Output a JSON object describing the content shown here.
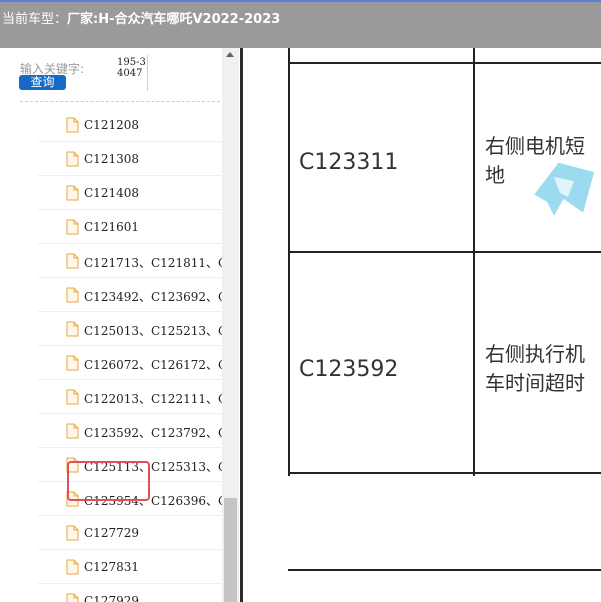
{
  "header": {
    "label": "当前车型：",
    "model": "厂家:H-合众汽车哪吒V2022-2023"
  },
  "sidebar": {
    "search": {
      "label": "输入关键字:",
      "value": "195-34047",
      "button": "查询"
    },
    "items": [
      "C121208",
      "C121308",
      "C121408",
      "C121601",
      "C121713、C121811、C",
      "C123492、C123692、C",
      "C125013、C125213、C",
      "C126072、C126172、C",
      "C122013、C122111、C",
      "C123592、C123792、C",
      "C125113、C125313、C",
      "C125954、C126396、C",
      "C127729",
      "C127831",
      "C127929"
    ]
  },
  "document": {
    "rows": [
      {
        "code": "C123311",
        "desc_line1": "右侧电机短",
        "desc_line2": "地"
      },
      {
        "code": "C123592",
        "desc_line1": "右侧执行机",
        "desc_line2": "车时间超时"
      }
    ]
  }
}
